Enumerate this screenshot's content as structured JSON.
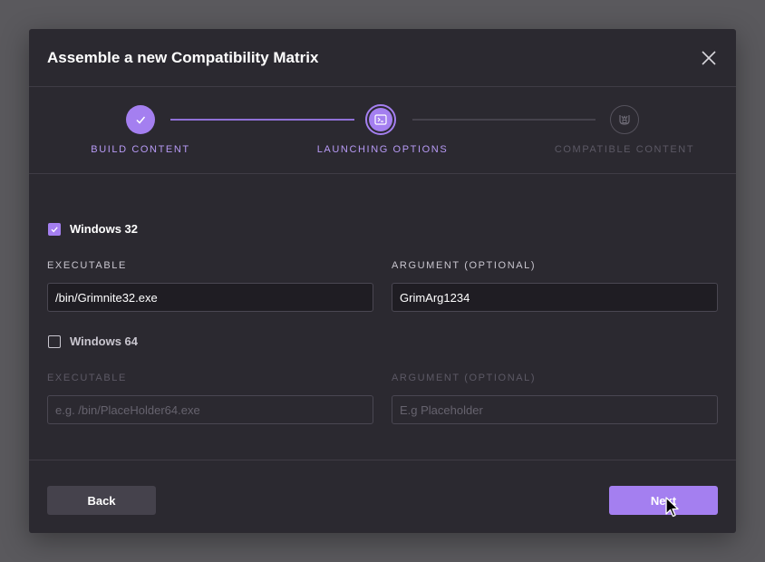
{
  "modal": {
    "title": "Assemble a new Compatibility Matrix",
    "close_icon": "close-icon"
  },
  "stepper": {
    "steps": [
      {
        "label": "BUILD CONTENT",
        "state": "completed",
        "icon": "check-icon"
      },
      {
        "label": "LAUNCHING OPTIONS",
        "state": "active",
        "icon": "terminal-icon"
      },
      {
        "label": "COMPATIBLE CONTENT",
        "state": "pending",
        "icon": "compatible-icon"
      }
    ]
  },
  "platforms": [
    {
      "name": "Windows 32",
      "checked": true,
      "executable_label": "EXECUTABLE",
      "executable_value": "/bin/Grimnite32.exe",
      "executable_placeholder": "",
      "argument_label": "ARGUMENT (OPTIONAL)",
      "argument_value": "GrimArg1234",
      "argument_placeholder": ""
    },
    {
      "name": "Windows 64",
      "checked": false,
      "executable_label": "EXECUTABLE",
      "executable_value": "",
      "executable_placeholder": "e.g. /bin/PlaceHolder64.exe",
      "argument_label": "ARGUMENT (OPTIONAL)",
      "argument_value": "",
      "argument_placeholder": "E.g Placeholder"
    }
  ],
  "footer": {
    "back_label": "Back",
    "next_label": "Next"
  },
  "colors": {
    "accent": "#a47ff0",
    "backdrop": "#5a595d",
    "modal_bg": "#2b2930",
    "muted_text": "#66636e"
  }
}
